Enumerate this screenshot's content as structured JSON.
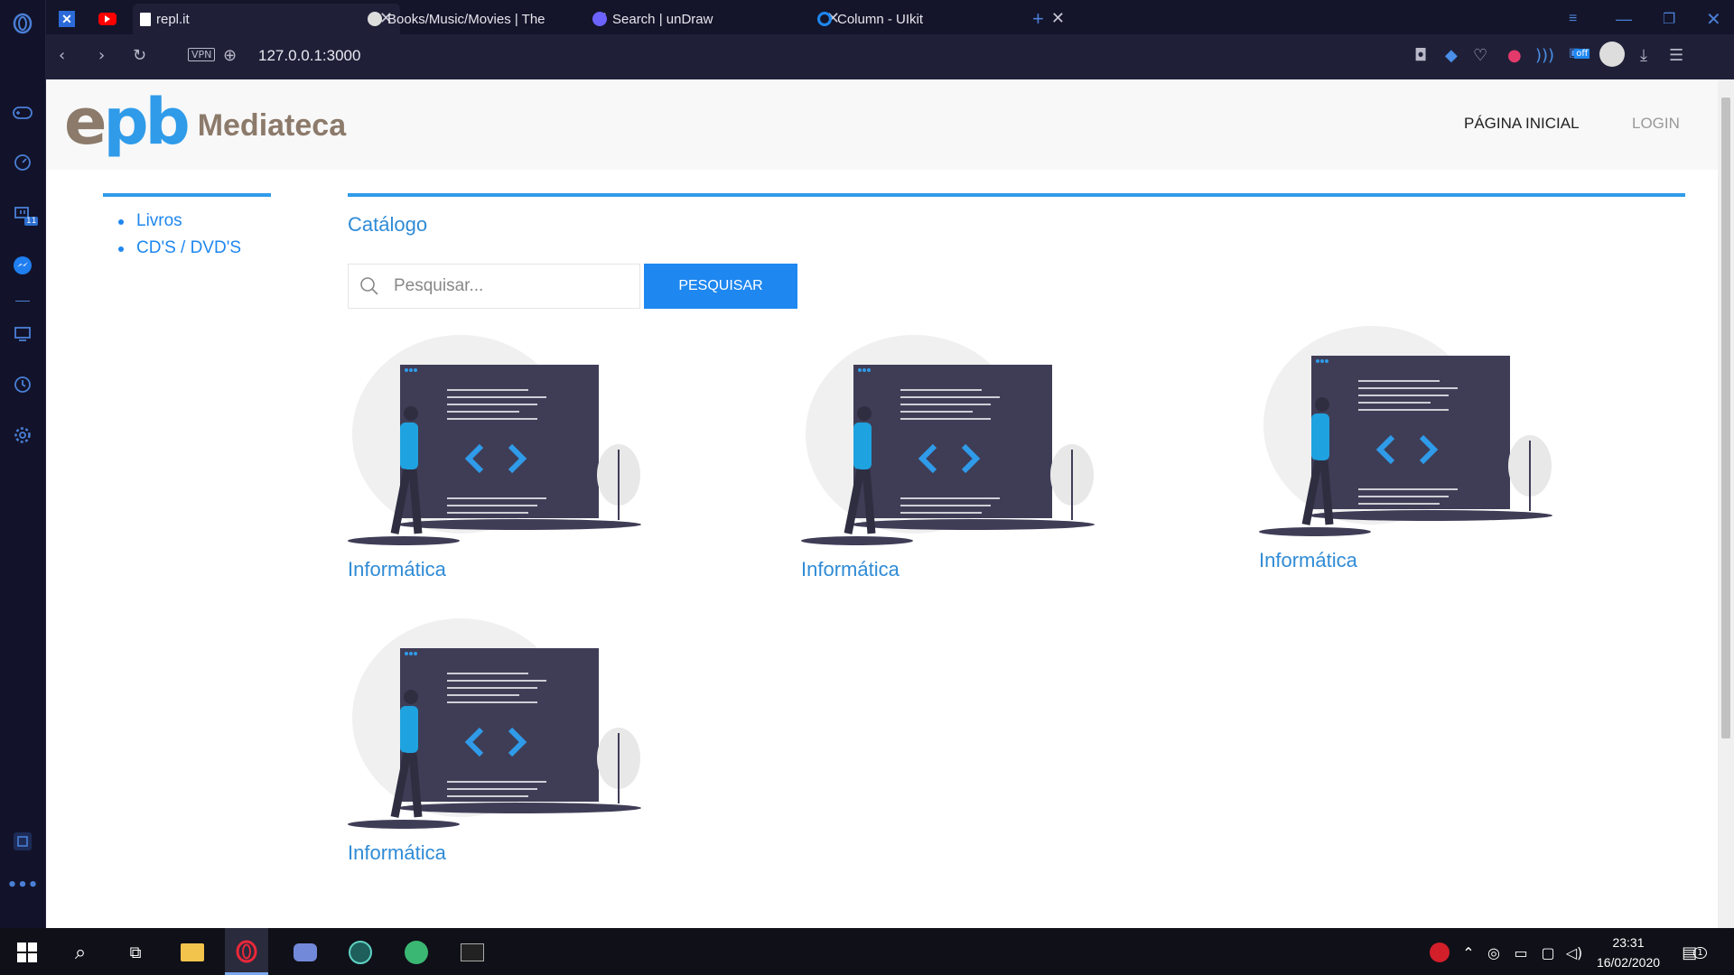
{
  "browser": {
    "tabs": [
      {
        "label": "repl.it",
        "active": true
      },
      {
        "label": "Books/Music/Movies | The"
      },
      {
        "label": "Search | unDraw"
      },
      {
        "label": "Column - UIkit"
      }
    ],
    "vpn_label": "VPN",
    "url": "127.0.0.1:3000",
    "sidebar_badge": "11",
    "battery_badge": "off"
  },
  "site": {
    "logo_mark": "epb",
    "logo_text": "Mediateca",
    "nav": {
      "home": "PÁGINA INICIAL",
      "login": "LOGIN"
    },
    "sidebar_items": [
      {
        "label": "Livros"
      },
      {
        "label": "CD'S / DVD'S"
      }
    ],
    "catalog_title": "Catálogo",
    "search": {
      "placeholder": "Pesquisar...",
      "button_label": "PESQUISAR"
    },
    "cards": [
      {
        "title": "Informática"
      },
      {
        "title": "Informática"
      },
      {
        "title": "Informática"
      },
      {
        "title": "Informática"
      }
    ]
  },
  "taskbar": {
    "time": "23:31",
    "date": "16/02/2020",
    "notification_count": "1"
  },
  "colors": {
    "accent": "#1e87f0",
    "logo_blue": "#2f9be9",
    "logo_brown": "#8c7a6b",
    "illustration_dark": "#3f3d56"
  }
}
